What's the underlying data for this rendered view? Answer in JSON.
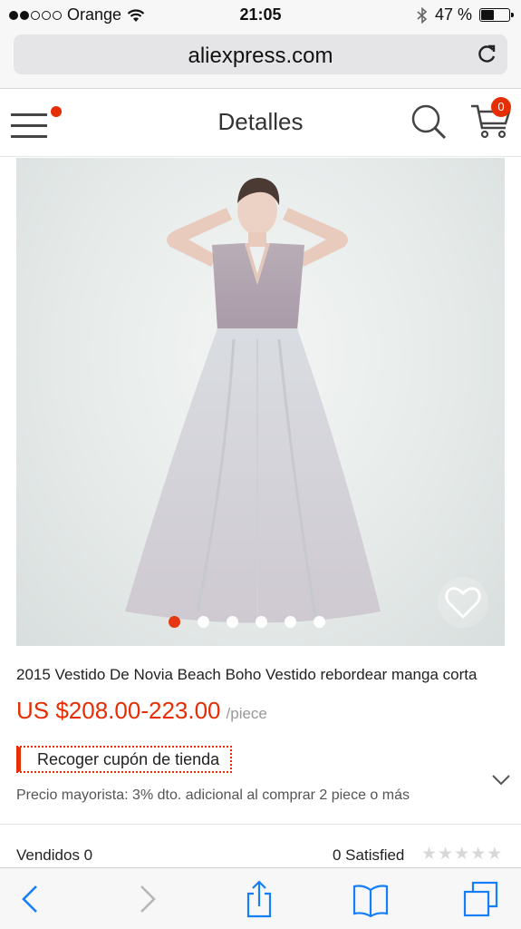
{
  "status_bar": {
    "carrier": "Orange",
    "time": "21:05",
    "battery_percent": 47,
    "battery_label": "47 %",
    "signal_bars_filled": 2,
    "signal_bars_total": 5
  },
  "browser": {
    "url": "aliexpress.com"
  },
  "header": {
    "title": "Detalles",
    "cart_count": "0"
  },
  "product": {
    "image_count": 6,
    "active_image_index": 0,
    "title": "2015 Vestido De Novia Beach Boho Vestido rebordear manga corta",
    "price": "US $208.00-223.00",
    "price_unit": "/piece",
    "coupon_label": "Recoger cupón de tienda",
    "wholesale_text": "Precio mayorista: 3% dto. adicional al comprar 2 piece o más",
    "sold_label": "Vendidos 0",
    "satisfied_label": "0 Satisfied",
    "rating_stars_filled": 0,
    "rating_stars_total": 5
  },
  "colors": {
    "accent": "#e62e04",
    "safari_blue": "#157efb"
  }
}
